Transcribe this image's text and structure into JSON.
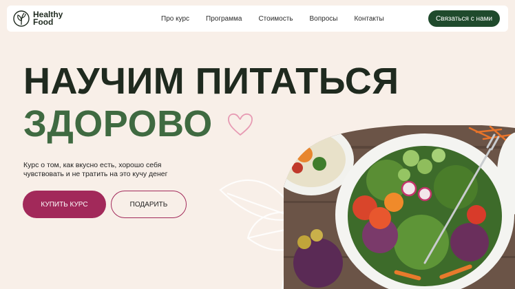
{
  "logo": {
    "line1": "Healthy",
    "line2": "Food"
  },
  "nav": {
    "items": [
      {
        "label": "Про курс"
      },
      {
        "label": "Программа"
      },
      {
        "label": "Стоимость"
      },
      {
        "label": "Вопросы"
      },
      {
        "label": "Контакты"
      }
    ]
  },
  "header": {
    "contact_label": "Связаться с нами"
  },
  "hero": {
    "title_line1": "НАУЧИМ ПИТАТЬСЯ",
    "title_line2": "ЗДОРОВО",
    "subtitle": "Курс о том, как вкусно есть, хорошо себя чувствовать и не тратить на это кучу денег",
    "buy_label": "КУПИТЬ КУРС",
    "gift_label": "ПОДАРИТЬ"
  },
  "colors": {
    "background": "#f8efe8",
    "brand_dark_green": "#1f4a2c",
    "accent_green": "#3f6a41",
    "accent_magenta": "#a2295a",
    "heart_pink": "#e79ab3"
  },
  "icons": {
    "logo": "leaf-logo-icon",
    "heart": "heart-outline-icon"
  }
}
